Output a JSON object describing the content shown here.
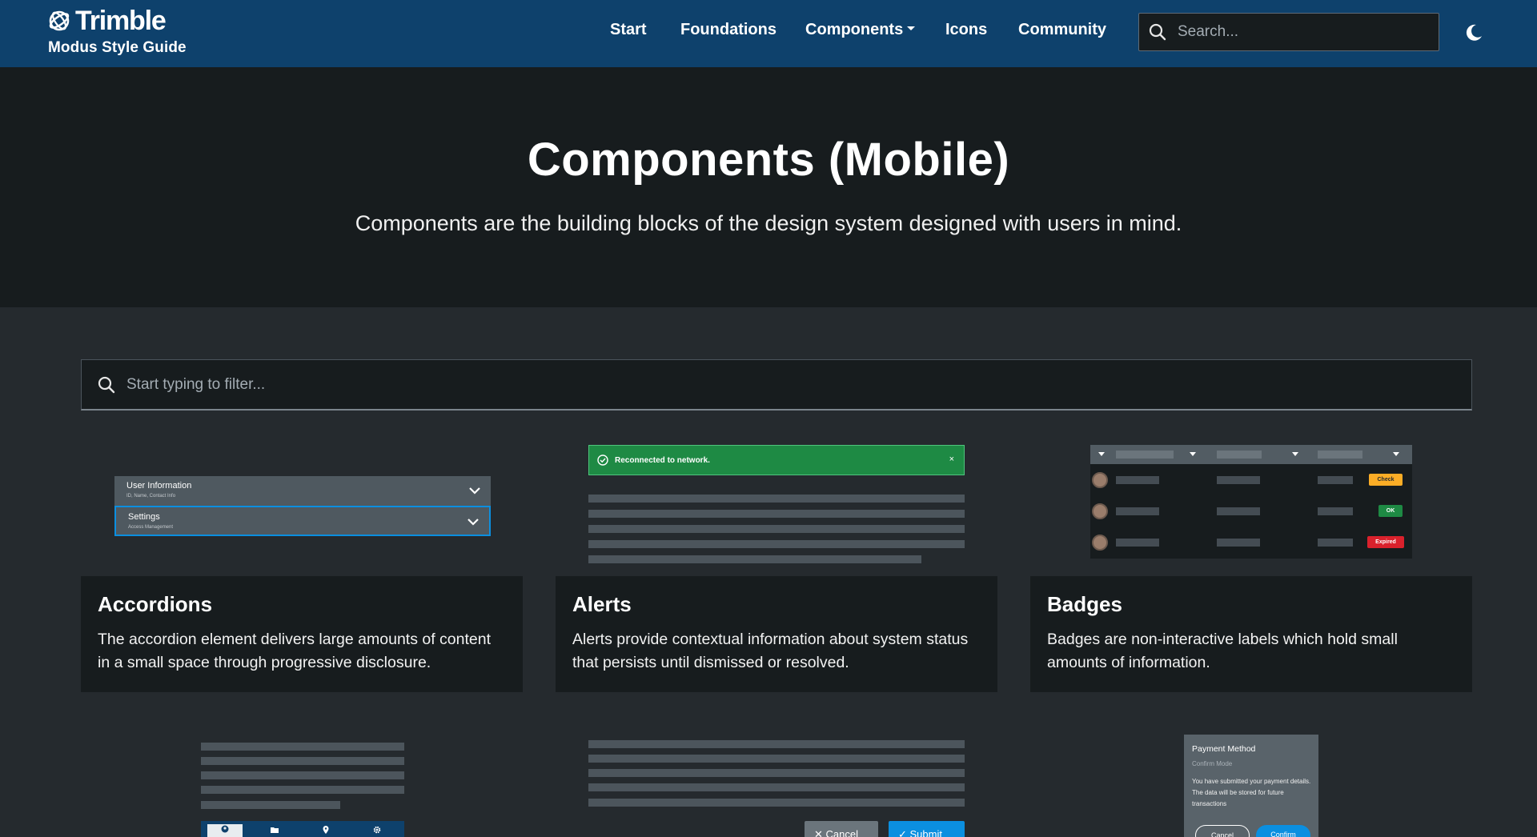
{
  "navbar": {
    "brand_name": "Trimble",
    "brand_sub": "Modus Style Guide",
    "links": [
      "Start",
      "Foundations",
      "Components",
      "Icons",
      "Community"
    ],
    "search_placeholder": "Search..."
  },
  "hero": {
    "title": "Components (Mobile)",
    "subtitle": "Components are the building blocks of the design system designed with users in mind."
  },
  "filter": {
    "placeholder": "Start typing to filter..."
  },
  "cards": [
    {
      "title": "Accordions",
      "description": "The accordion element delivers large amounts of content in a small space through progressive disclosure.",
      "preview": {
        "items": [
          {
            "title": "User Information",
            "subtitle": "ID, Name, Contact Info"
          },
          {
            "title": "Settings",
            "subtitle": "Access Management"
          }
        ]
      }
    },
    {
      "title": "Alerts",
      "description": "Alerts provide contextual information about system status that persists until dismissed or resolved.",
      "preview": {
        "message": "Reconnected to network.",
        "close": "×"
      }
    },
    {
      "title": "Badges",
      "description": "Badges are non-interactive labels which hold small amounts of information.",
      "preview": {
        "badges": [
          {
            "label": "Check",
            "color": "#fbad26"
          },
          {
            "label": "OK",
            "color": "#1e8a44"
          },
          {
            "label": "Expired",
            "color": "#da212c"
          }
        ]
      }
    }
  ],
  "bottom_previews": {
    "buttons": {
      "cancel": "Cancel",
      "submit": "Submit"
    },
    "modal": {
      "title": "Payment Method",
      "subtitle": "Confirm Mode",
      "body": "You have submitted your payment details. The data will be stored for future transactions",
      "cancel": "Cancel",
      "confirm": "Confirm"
    }
  },
  "colors": {
    "nav_bg": "#0e416c",
    "hero_bg": "#171c1e",
    "page_bg": "#252a2e",
    "accent": "#0b8fe0",
    "success": "#1e8a44"
  }
}
